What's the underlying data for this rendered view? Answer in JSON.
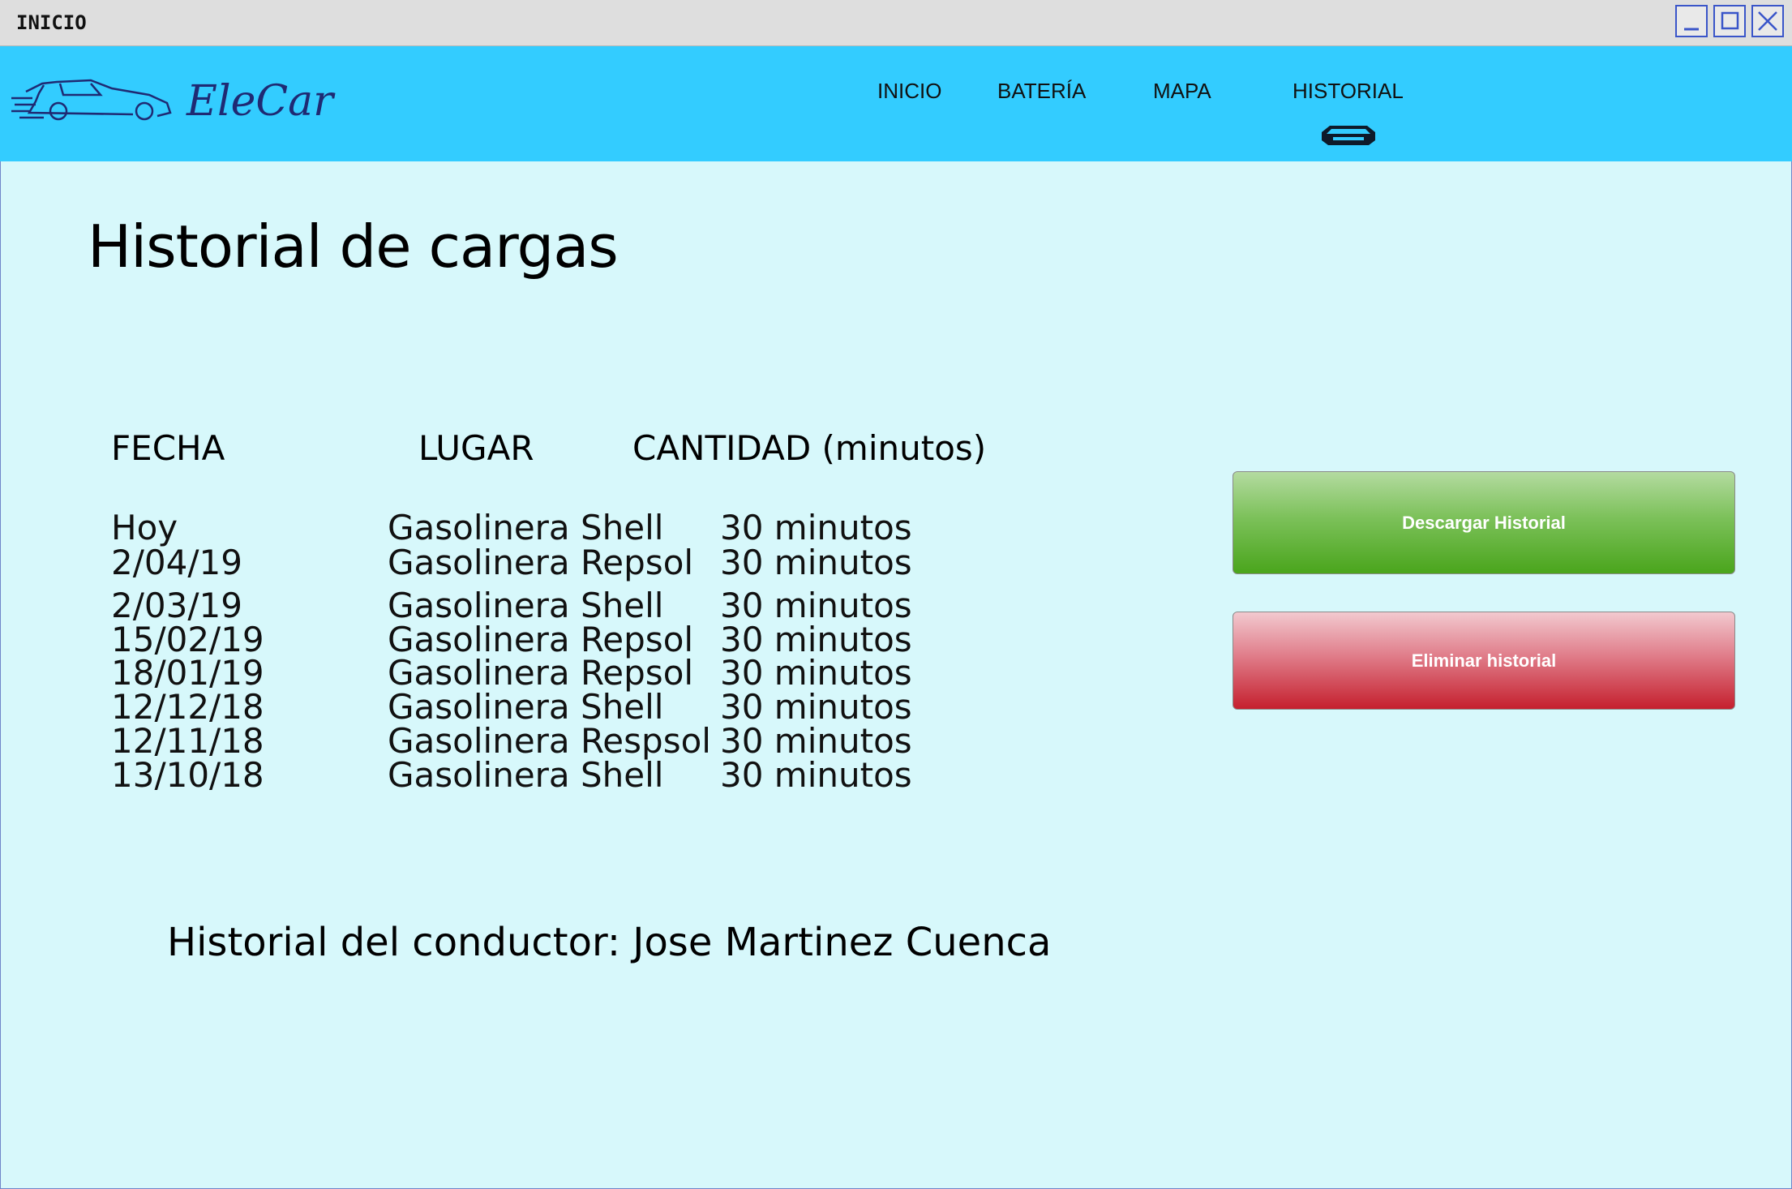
{
  "window": {
    "title": "INICIO",
    "controls": [
      "minimize-icon",
      "maximize-icon",
      "close-icon"
    ]
  },
  "header": {
    "brand": "EleCar",
    "nav": [
      {
        "label": "INICIO"
      },
      {
        "label": "BATERÍA"
      },
      {
        "label": "MAPA"
      },
      {
        "label": "HISTORIAL",
        "active": true
      }
    ],
    "colors": {
      "header_bg": "#33ccff",
      "page_bg": "#d7f8fb",
      "brand_text": "#1f2a73"
    }
  },
  "main": {
    "title": "Historial de cargas",
    "columns": [
      "FECHA",
      "LUGAR",
      "CANTIDAD (minutos)"
    ],
    "rows": [
      {
        "fecha": "Hoy",
        "lugar": "Gasolinera Shell",
        "cantidad": "30 minutos"
      },
      {
        "fecha": "2/04/19",
        "lugar": "Gasolinera Repsol",
        "cantidad": "30 minutos"
      },
      {
        "fecha": "2/03/19",
        "lugar": "Gasolinera Shell",
        "cantidad": "30 minutos"
      },
      {
        "fecha": "15/02/19",
        "lugar": "Gasolinera Repsol",
        "cantidad": "30 minutos"
      },
      {
        "fecha": "18/01/19",
        "lugar": "Gasolinera Repsol",
        "cantidad": "30 minutos"
      },
      {
        "fecha": "12/12/18",
        "lugar": "Gasolinera Shell",
        "cantidad": "30 minutos"
      },
      {
        "fecha": "12/11/18",
        "lugar": "Gasolinera Respsol",
        "cantidad": "30 minutos"
      },
      {
        "fecha": "13/10/18",
        "lugar": "Gasolinera Shell",
        "cantidad": "30 minutos"
      }
    ],
    "driver_label": "Historial del conductor:",
    "driver_name": "Jose Martinez Cuenca",
    "buttons": {
      "download": "Descargar Historial",
      "delete": "Eliminar historial"
    },
    "colors": {
      "download": "#4aa51c",
      "delete": "#c5202e"
    }
  }
}
